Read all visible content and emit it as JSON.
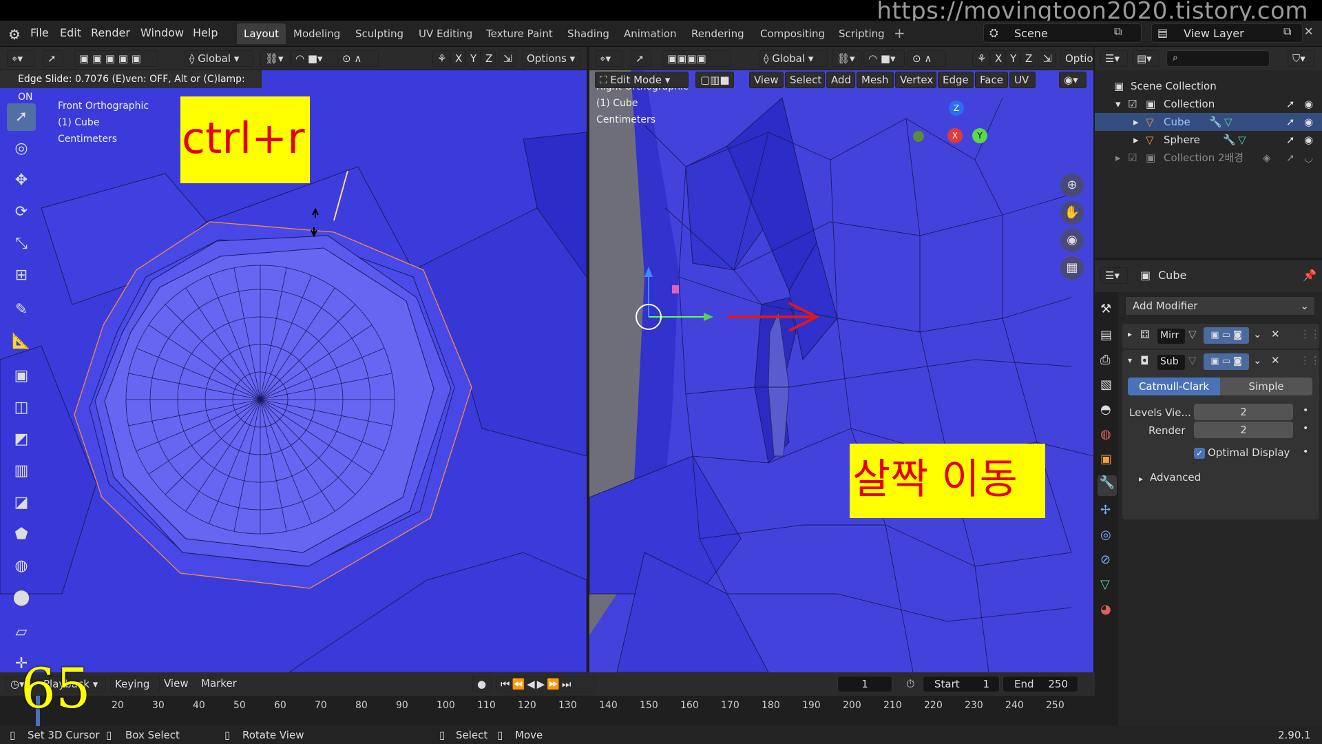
{
  "watermark": "https://movingtoon2020.tistory.com",
  "menus": [
    "File",
    "Edit",
    "Render",
    "Window",
    "Help"
  ],
  "workspaces": [
    "Layout",
    "Modeling",
    "Sculpting",
    "UV Editing",
    "Texture Paint",
    "Shading",
    "Animation",
    "Rendering",
    "Compositing",
    "Scripting"
  ],
  "scene": "Scene",
  "view_layer": "View Layer",
  "left_header": {
    "transform": "Global",
    "options": "Options",
    "axes": [
      "X",
      "Y",
      "Z"
    ]
  },
  "right_header": {
    "transform": "Global",
    "options": "Optio",
    "axes": [
      "X",
      "Y",
      "Z"
    ]
  },
  "operator_status": "Edge Slide: 0.7076 (E)ven: OFF, Alt or (C)lamp: ON",
  "edit_header": {
    "mode": "Edit Mode",
    "items": [
      "View",
      "Select",
      "Add",
      "Mesh",
      "Vertex",
      "Edge",
      "Face",
      "UV"
    ]
  },
  "left_vp": {
    "lines": [
      "Front Orthographic",
      "(1) Cube",
      "Centimeters"
    ],
    "caption": "ctrl+r"
  },
  "right_vp": {
    "lines": [
      "Right Orthographic",
      "(1) Cube",
      "Centimeters"
    ],
    "caption": "살짝 이동"
  },
  "gizmo": {
    "z": "Z",
    "x": "X",
    "y": "Y"
  },
  "outliner": {
    "title": "Scene Collection",
    "items": [
      {
        "label": "Collection"
      },
      {
        "label": "Cube"
      },
      {
        "label": "Sphere"
      },
      {
        "label": "Collection 2배경"
      }
    ]
  },
  "properties": {
    "object": "Cube",
    "add_modifier": "Add Modifier",
    "mod1": "Mirr",
    "mod2": "Sub",
    "tab1": "Catmull-Clark",
    "tab2": "Simple",
    "levels_label": "Levels Vie...",
    "levels_value": "2",
    "render_label": "Render",
    "render_value": "2",
    "optimal": "Optimal Display",
    "advanced": "Advanced"
  },
  "timeline": {
    "playback": "Playback",
    "keying": "Keying",
    "view": "View",
    "marker": "Marker",
    "frame": "1",
    "start_label": "Start",
    "start": "1",
    "end_label": "End",
    "end": "250",
    "ticks": [
      "20",
      "30",
      "40",
      "50",
      "60",
      "70",
      "80",
      "90",
      "100",
      "110",
      "120",
      "130",
      "140",
      "150",
      "160",
      "170",
      "180",
      "190",
      "200",
      "210",
      "220",
      "230",
      "240",
      "250"
    ]
  },
  "overlay_number": "65",
  "status": {
    "set_cursor": "Set 3D Cursor",
    "box_select": "Box Select",
    "rotate": "Rotate View",
    "select": "Select",
    "move": "Move",
    "version": "2.90.1"
  },
  "colors": {
    "viewport_blue": "#3a3ad8",
    "highlight": "#ffff00",
    "arrow": "#e01818"
  }
}
